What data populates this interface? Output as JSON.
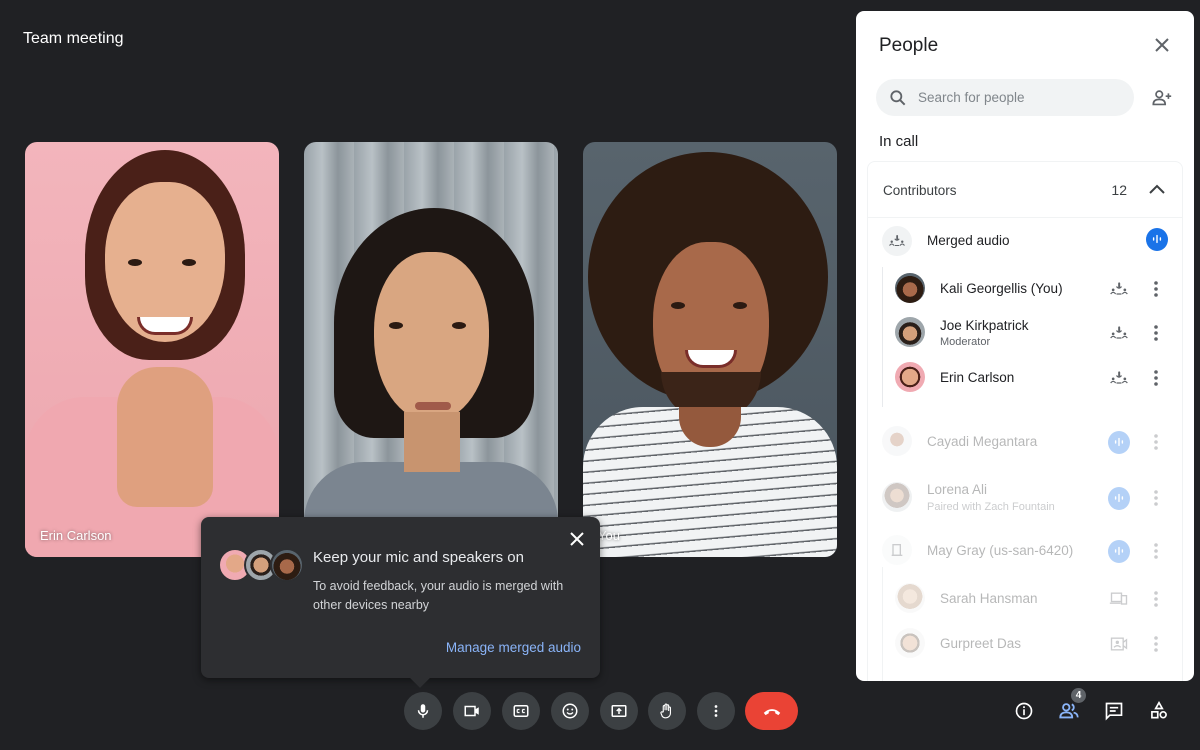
{
  "meeting": {
    "title": "Team meeting"
  },
  "tiles": [
    {
      "name": "Erin Carlson"
    },
    {
      "name": ""
    },
    {
      "name": "You"
    }
  ],
  "popup": {
    "title": "Keep your mic and speakers on",
    "body": "To avoid feedback, your audio is merged with other devices nearby",
    "link": "Manage merged audio",
    "close_icon": "close-icon"
  },
  "controls": [
    {
      "name": "mic",
      "icon": "mic-icon"
    },
    {
      "name": "camera",
      "icon": "videocam-icon"
    },
    {
      "name": "captions",
      "icon": "closed-captions-icon"
    },
    {
      "name": "reactions",
      "icon": "emoji-icon"
    },
    {
      "name": "present",
      "icon": "present-screen-icon"
    },
    {
      "name": "raise-hand",
      "icon": "hand-icon"
    },
    {
      "name": "more-options",
      "icon": "more-vert-icon"
    },
    {
      "name": "leave-call",
      "icon": "call-end-icon",
      "color": "#ea4335"
    }
  ],
  "side_controls": {
    "info": "info-icon",
    "people": "people-icon",
    "people_badge": "4",
    "chat": "chat-icon",
    "activities": "shapes-icon"
  },
  "panel": {
    "title": "People",
    "search_placeholder": "Search for people",
    "in_call_label": "In call",
    "contributors_label": "Contributors",
    "contributors_count": "12",
    "merged_audio_label": "Merged audio",
    "accent_color": "#1a73e8",
    "merged_members": [
      {
        "name": "Kali Georgellis (You)",
        "sub": ""
      },
      {
        "name": "Joe Kirkpatrick",
        "sub": "Moderator"
      },
      {
        "name": "Erin Carlson",
        "sub": ""
      }
    ],
    "others": [
      {
        "name": "Cayadi Megantara",
        "sub": "",
        "status": "speaking"
      },
      {
        "name": "Lorena Ali",
        "sub": "Paired with  Zach Fountain",
        "status": "speaking"
      },
      {
        "name": "May Gray (us-san-6420)",
        "sub": "",
        "status": "speaking"
      },
      {
        "name": "Sarah Hansman",
        "sub": "",
        "status": "companion-device"
      },
      {
        "name": "Gurpreet Das",
        "sub": "",
        "status": "camera-off"
      }
    ]
  }
}
